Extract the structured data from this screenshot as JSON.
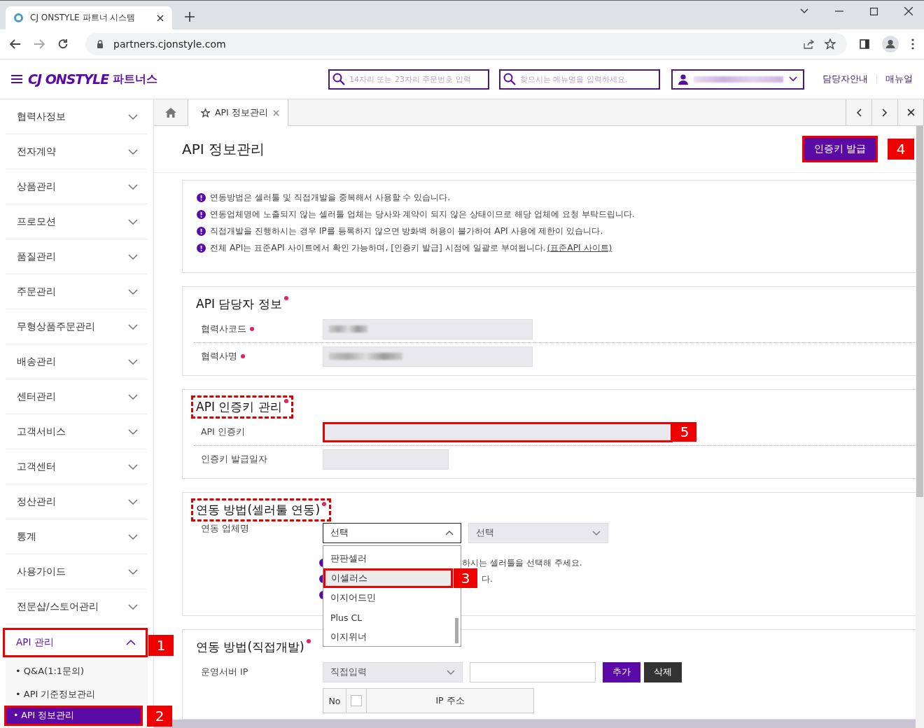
{
  "browser": {
    "tab_title": "CJ ONSTYLE 파트너 시스템",
    "url": "partners.cjonstyle.com"
  },
  "header": {
    "logo": "CJ ONSTYLE",
    "logo_suffix": "파트너스",
    "order_search": {
      "placeholder": "14자리 또는 23자리 주문번호 입력"
    },
    "menu_search": {
      "placeholder": "찾으시는 메뉴명을 입력하세요."
    },
    "links": [
      "담당자안내",
      "매뉴얼"
    ]
  },
  "sidebar": {
    "items": [
      {
        "label": "협력사정보",
        "expanded": false
      },
      {
        "label": "전자계약",
        "expanded": false
      },
      {
        "label": "상품관리",
        "expanded": false
      },
      {
        "label": "프로모션",
        "expanded": false
      },
      {
        "label": "품질관리",
        "expanded": false
      },
      {
        "label": "주문관리",
        "expanded": false
      },
      {
        "label": "무형상품주문관리",
        "expanded": false
      },
      {
        "label": "배송관리",
        "expanded": false
      },
      {
        "label": "센터관리",
        "expanded": false
      },
      {
        "label": "고객서비스",
        "expanded": false
      },
      {
        "label": "고객센터",
        "expanded": false
      },
      {
        "label": "정산관리",
        "expanded": false
      },
      {
        "label": "통계",
        "expanded": false
      },
      {
        "label": "사용가이드",
        "expanded": false
      },
      {
        "label": "전문샵/스토어관리",
        "expanded": false
      },
      {
        "label": "API 관리",
        "expanded": true,
        "callout": "1",
        "children": [
          {
            "label": "• Q&A(1:1문의)",
            "selected": false
          },
          {
            "label": "• API 기준정보관리",
            "selected": false
          },
          {
            "label": "• API 정보관리",
            "selected": true,
            "callout": "2"
          }
        ]
      }
    ]
  },
  "tabs": [
    {
      "label": "API 정보관리",
      "selected": true
    }
  ],
  "page": {
    "title": "API 정보관리",
    "issue_button": {
      "label": "인증키 발급",
      "callout": "4"
    }
  },
  "notices": [
    {
      "text": "연동방법은 셀러툴 및 직접개발을 중복해서 사용할 수 있습니다."
    },
    {
      "text": "연동업체명에 노출되지 않는 셀러툴 업체는 당사와 계약이 되지 않은 상태이므로 해당 업체에 요청 부탁드립니다."
    },
    {
      "text": "직접개발을 진행하시는 경우 IP를 등록하지 않으면 방화벽 허용이 불가하여 API 사용에 제한이 있습니다."
    },
    {
      "text": "전체 API는 표준API 사이트에서 확인 가능하며, [인증키 발급] 시점에 일괄로 부여됩니다.",
      "link": "(표준API 사이트)"
    }
  ],
  "sections": [
    {
      "kind": "fields",
      "title": "API 담당자 정보",
      "required": true,
      "highlighted": false,
      "rows": [
        {
          "label": "협력사코드",
          "required": true,
          "kind": "code",
          "redacted": true
        },
        {
          "label": "협력사명",
          "required": true,
          "kind": "name",
          "redacted": true
        }
      ]
    },
    {
      "kind": "fields",
      "title": "API 인증키 관리",
      "required": true,
      "highlighted": true,
      "rows": [
        {
          "label": "API 인증키",
          "required": false,
          "kind": "key",
          "redacted": false,
          "callout": "5"
        },
        {
          "label": "인증키 발급일자",
          "required": false,
          "kind": "date",
          "redacted": false
        }
      ]
    },
    {
      "kind": "seller",
      "title": "연동 방법(셀러툴 연동)",
      "required": true,
      "highlighted": true,
      "label": "연동 업체명",
      "select": {
        "value": "선택",
        "open": true,
        "options": [
          {
            "label": "판판셀러",
            "selected": false
          },
          {
            "label": "이셀러스",
            "selected": true,
            "callout": "3"
          },
          {
            "label": "이지어드민",
            "selected": false
          },
          {
            "label": "Plus CL",
            "selected": false
          },
          {
            "label": "이지위너",
            "selected": false
          }
        ]
      },
      "select2": {
        "value": "선택"
      },
      "notes": [
        {
          "kind": "text",
          "text": "하시는 셀러툴을 선택해 주세요."
        },
        {
          "kind": "text",
          "text": "다."
        },
        {
          "kind": "covered"
        }
      ]
    },
    {
      "kind": "direct",
      "title": "연동 방법(직접개발)",
      "required": true,
      "highlighted": false,
      "label": "운영서버 IP",
      "select": {
        "value": "직접입력"
      },
      "buttons": [
        {
          "label": "추가",
          "kind": "primary"
        },
        {
          "label": "삭제",
          "kind": "dark"
        }
      ],
      "table": {
        "columns": [
          "No",
          "IP 주소"
        ],
        "checked": false
      }
    }
  ]
}
